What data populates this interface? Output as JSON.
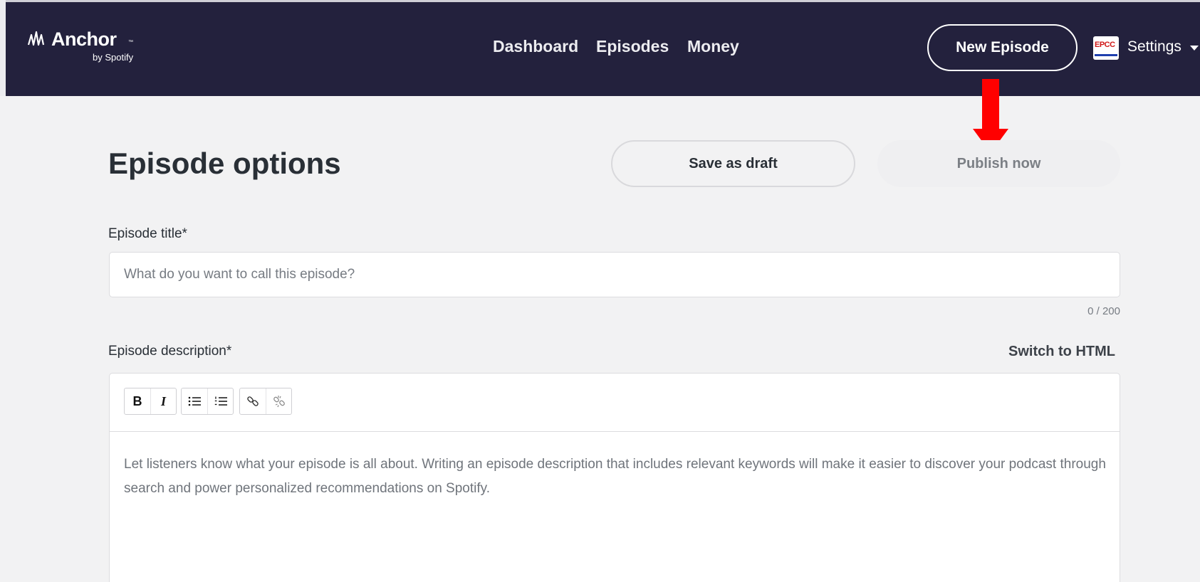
{
  "header": {
    "logo": {
      "name": "Anchor",
      "tm": "™",
      "subtitle": "by Spotify"
    },
    "nav": [
      "Dashboard",
      "Episodes",
      "Money"
    ],
    "new_episode_label": "New Episode",
    "avatar_text": "EPCC",
    "settings_label": "Settings"
  },
  "main": {
    "title": "Episode options",
    "save_draft_label": "Save as draft",
    "publish_label": "Publish now",
    "episode_title": {
      "label": "Episode title*",
      "placeholder": "What do you want to call this episode?",
      "value": "",
      "counter": "0 / 200"
    },
    "episode_description": {
      "label": "Episode description*",
      "switch_label": "Switch to HTML",
      "toolbar": {
        "bold": "B",
        "italic": "I"
      },
      "placeholder": "Let listeners know what your episode is all about. Writing an episode description that includes relevant keywords will make it easier to discover your podcast through search and power personalized recommendations on Spotify."
    }
  },
  "annotation": {
    "arrow_color": "#ff0000",
    "points_to": "publish-now-button"
  },
  "colors": {
    "topbar": "#23213d",
    "accent_text": "#ffffff",
    "page_bg": "#f2f2f3"
  }
}
